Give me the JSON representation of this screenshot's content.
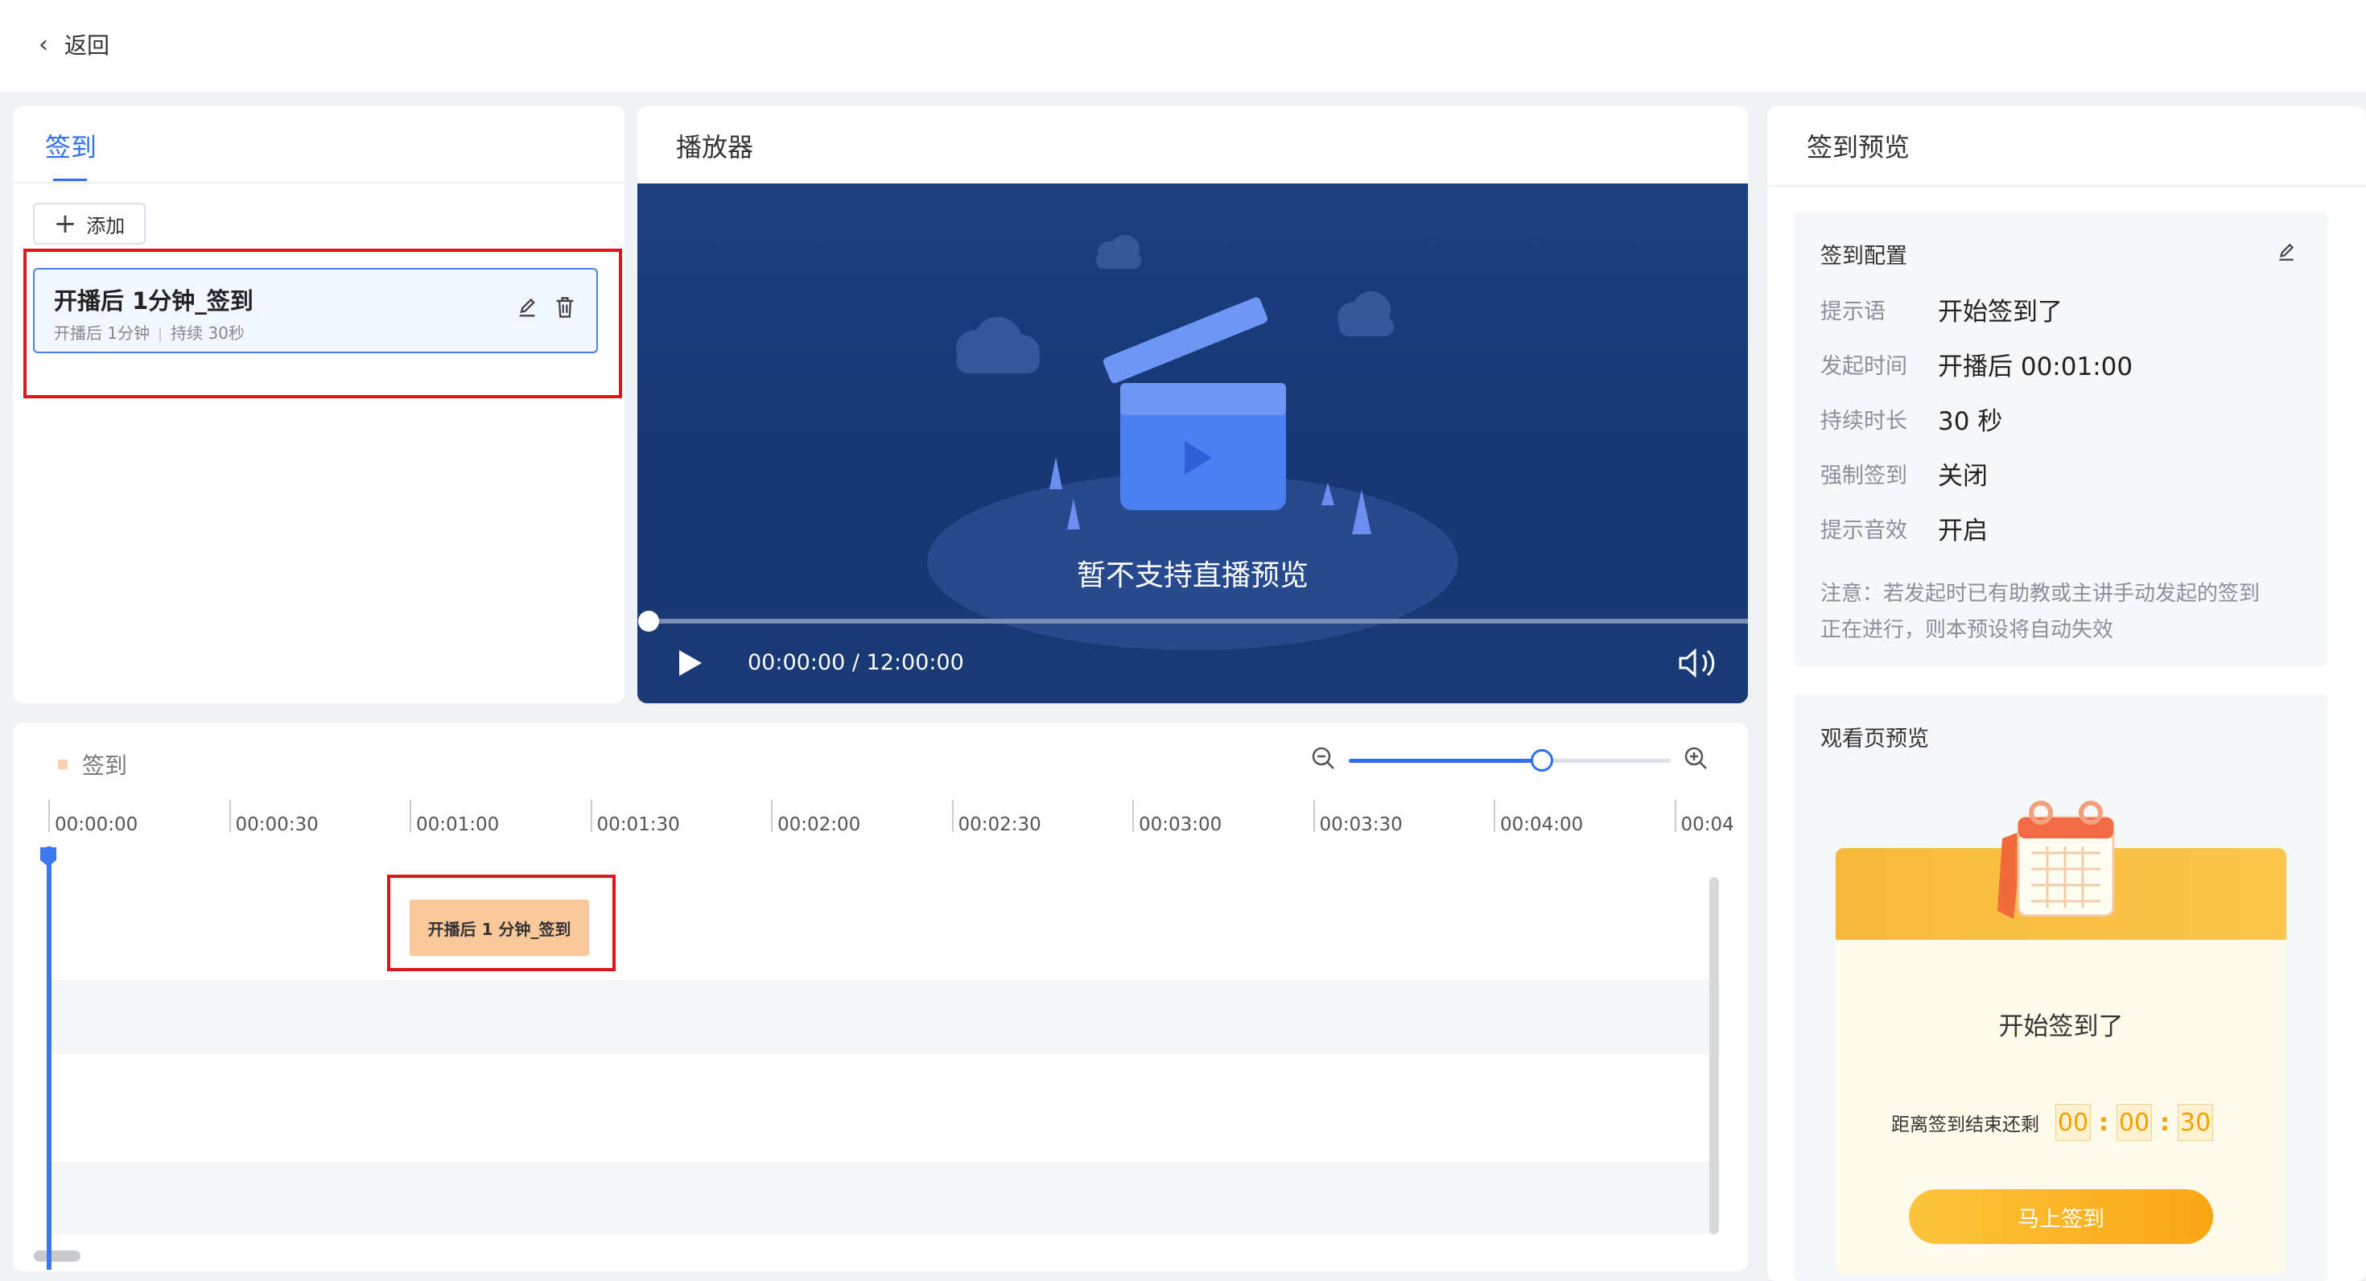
{
  "header": {
    "back_label": "返回"
  },
  "left_panel": {
    "tab_label": "签到",
    "add_label": "添加",
    "item": {
      "title": "开播后 1分钟_签到",
      "start": "开播后 1分钟",
      "duration": "持续 30秒"
    }
  },
  "player": {
    "title": "播放器",
    "no_live": "暂不支持直播预览",
    "time": "00:00:00 / 12:00:00",
    "progress": 0
  },
  "preview": {
    "title": "签到预览",
    "config": {
      "title": "签到配置",
      "rows": [
        {
          "label": "提示语",
          "value": "开始签到了"
        },
        {
          "label": "发起时间",
          "value": "开播后 00:01:00"
        },
        {
          "label": "持续时长",
          "value": "30 秒"
        },
        {
          "label": "强制签到",
          "value": "关闭"
        },
        {
          "label": "提示音效",
          "value": "开启"
        }
      ],
      "notice_line1": "注意：若发起时已有助教或主讲手动发起的签到",
      "notice_line2": "正在进行，则本预设将自动失效"
    },
    "watch": {
      "title": "观看页预览",
      "start_text": "开始签到了",
      "countdown_label": "距离签到结束还剩",
      "hh": "00",
      "mm": "00",
      "ss": "30",
      "button": "马上签到"
    }
  },
  "timeline": {
    "legend": "签到",
    "zoom_level": 0.6,
    "ticks": [
      "00:00:00",
      "00:00:30",
      "00:01:00",
      "00:01:30",
      "00:02:00",
      "00:02:30",
      "00:03:00",
      "00:03:30",
      "00:04:00",
      "00:04"
    ],
    "event_label": "开播后 1 分钟_签到"
  },
  "colors": {
    "accent": "#2f6ff0",
    "highlight": "#e1141a",
    "event": "#fbc89c",
    "gold": "#f2a200"
  }
}
